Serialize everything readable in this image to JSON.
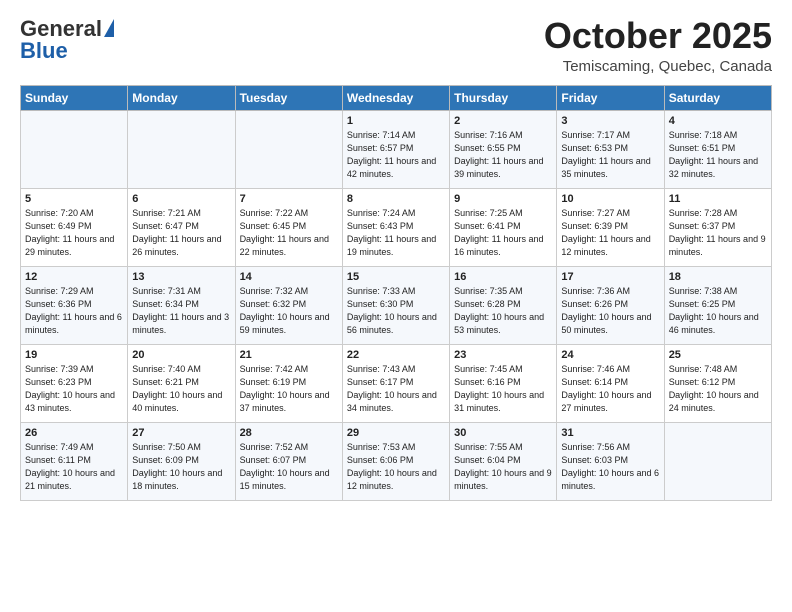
{
  "logo": {
    "line1": "General",
    "line2": "Blue"
  },
  "title": "October 2025",
  "subtitle": "Temiscaming, Quebec, Canada",
  "days_header": [
    "Sunday",
    "Monday",
    "Tuesday",
    "Wednesday",
    "Thursday",
    "Friday",
    "Saturday"
  ],
  "weeks": [
    [
      {
        "day": "",
        "info": ""
      },
      {
        "day": "",
        "info": ""
      },
      {
        "day": "",
        "info": ""
      },
      {
        "day": "1",
        "info": "Sunrise: 7:14 AM\nSunset: 6:57 PM\nDaylight: 11 hours and 42 minutes."
      },
      {
        "day": "2",
        "info": "Sunrise: 7:16 AM\nSunset: 6:55 PM\nDaylight: 11 hours and 39 minutes."
      },
      {
        "day": "3",
        "info": "Sunrise: 7:17 AM\nSunset: 6:53 PM\nDaylight: 11 hours and 35 minutes."
      },
      {
        "day": "4",
        "info": "Sunrise: 7:18 AM\nSunset: 6:51 PM\nDaylight: 11 hours and 32 minutes."
      }
    ],
    [
      {
        "day": "5",
        "info": "Sunrise: 7:20 AM\nSunset: 6:49 PM\nDaylight: 11 hours and 29 minutes."
      },
      {
        "day": "6",
        "info": "Sunrise: 7:21 AM\nSunset: 6:47 PM\nDaylight: 11 hours and 26 minutes."
      },
      {
        "day": "7",
        "info": "Sunrise: 7:22 AM\nSunset: 6:45 PM\nDaylight: 11 hours and 22 minutes."
      },
      {
        "day": "8",
        "info": "Sunrise: 7:24 AM\nSunset: 6:43 PM\nDaylight: 11 hours and 19 minutes."
      },
      {
        "day": "9",
        "info": "Sunrise: 7:25 AM\nSunset: 6:41 PM\nDaylight: 11 hours and 16 minutes."
      },
      {
        "day": "10",
        "info": "Sunrise: 7:27 AM\nSunset: 6:39 PM\nDaylight: 11 hours and 12 minutes."
      },
      {
        "day": "11",
        "info": "Sunrise: 7:28 AM\nSunset: 6:37 PM\nDaylight: 11 hours and 9 minutes."
      }
    ],
    [
      {
        "day": "12",
        "info": "Sunrise: 7:29 AM\nSunset: 6:36 PM\nDaylight: 11 hours and 6 minutes."
      },
      {
        "day": "13",
        "info": "Sunrise: 7:31 AM\nSunset: 6:34 PM\nDaylight: 11 hours and 3 minutes."
      },
      {
        "day": "14",
        "info": "Sunrise: 7:32 AM\nSunset: 6:32 PM\nDaylight: 10 hours and 59 minutes."
      },
      {
        "day": "15",
        "info": "Sunrise: 7:33 AM\nSunset: 6:30 PM\nDaylight: 10 hours and 56 minutes."
      },
      {
        "day": "16",
        "info": "Sunrise: 7:35 AM\nSunset: 6:28 PM\nDaylight: 10 hours and 53 minutes."
      },
      {
        "day": "17",
        "info": "Sunrise: 7:36 AM\nSunset: 6:26 PM\nDaylight: 10 hours and 50 minutes."
      },
      {
        "day": "18",
        "info": "Sunrise: 7:38 AM\nSunset: 6:25 PM\nDaylight: 10 hours and 46 minutes."
      }
    ],
    [
      {
        "day": "19",
        "info": "Sunrise: 7:39 AM\nSunset: 6:23 PM\nDaylight: 10 hours and 43 minutes."
      },
      {
        "day": "20",
        "info": "Sunrise: 7:40 AM\nSunset: 6:21 PM\nDaylight: 10 hours and 40 minutes."
      },
      {
        "day": "21",
        "info": "Sunrise: 7:42 AM\nSunset: 6:19 PM\nDaylight: 10 hours and 37 minutes."
      },
      {
        "day": "22",
        "info": "Sunrise: 7:43 AM\nSunset: 6:17 PM\nDaylight: 10 hours and 34 minutes."
      },
      {
        "day": "23",
        "info": "Sunrise: 7:45 AM\nSunset: 6:16 PM\nDaylight: 10 hours and 31 minutes."
      },
      {
        "day": "24",
        "info": "Sunrise: 7:46 AM\nSunset: 6:14 PM\nDaylight: 10 hours and 27 minutes."
      },
      {
        "day": "25",
        "info": "Sunrise: 7:48 AM\nSunset: 6:12 PM\nDaylight: 10 hours and 24 minutes."
      }
    ],
    [
      {
        "day": "26",
        "info": "Sunrise: 7:49 AM\nSunset: 6:11 PM\nDaylight: 10 hours and 21 minutes."
      },
      {
        "day": "27",
        "info": "Sunrise: 7:50 AM\nSunset: 6:09 PM\nDaylight: 10 hours and 18 minutes."
      },
      {
        "day": "28",
        "info": "Sunrise: 7:52 AM\nSunset: 6:07 PM\nDaylight: 10 hours and 15 minutes."
      },
      {
        "day": "29",
        "info": "Sunrise: 7:53 AM\nSunset: 6:06 PM\nDaylight: 10 hours and 12 minutes."
      },
      {
        "day": "30",
        "info": "Sunrise: 7:55 AM\nSunset: 6:04 PM\nDaylight: 10 hours and 9 minutes."
      },
      {
        "day": "31",
        "info": "Sunrise: 7:56 AM\nSunset: 6:03 PM\nDaylight: 10 hours and 6 minutes."
      },
      {
        "day": "",
        "info": ""
      }
    ]
  ]
}
